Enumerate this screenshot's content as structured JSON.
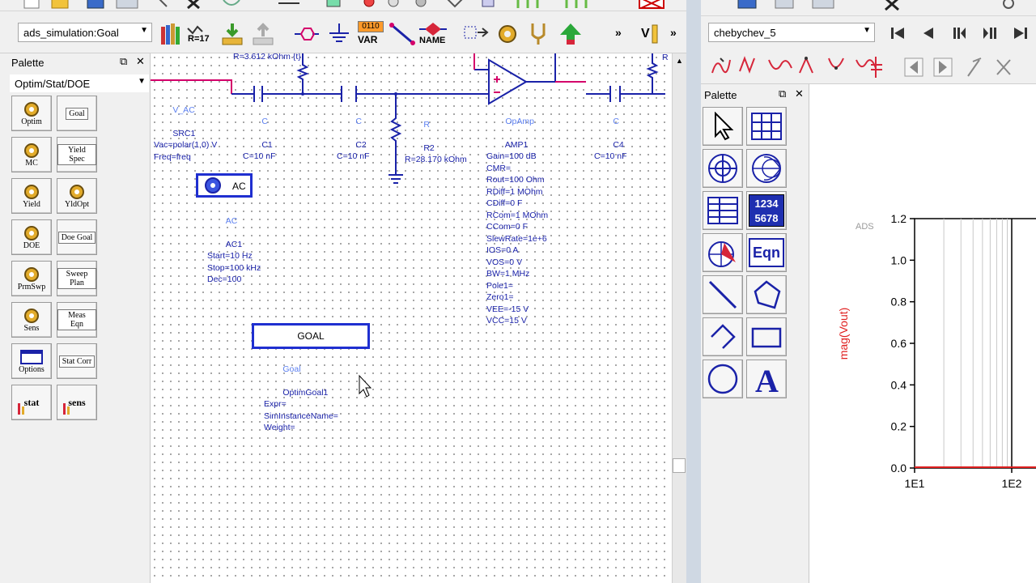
{
  "left": {
    "design_combo": "ads_simulation:Goal",
    "toolbar_texts": {
      "r17": "R=17",
      "var": "VAR",
      "var_bits": "0110",
      "name": "NAME",
      "more": "»",
      "vi": "V"
    },
    "palette": {
      "title": "Palette",
      "float": "⧉",
      "close": "✕",
      "category": "Optim/Stat/DOE",
      "items": [
        {
          "label": "Optim"
        },
        {
          "label": "Goal"
        },
        {
          "label": "MC"
        },
        {
          "label": "Yield Spec"
        },
        {
          "label": "Yield"
        },
        {
          "label": "YldOpt"
        },
        {
          "label": "DOE"
        },
        {
          "label": "Doe Goal"
        },
        {
          "label": "PrmSwp"
        },
        {
          "label": "Sweep Plan"
        },
        {
          "label": "Sens"
        },
        {
          "label": "Meas Eqn"
        },
        {
          "label": "Options"
        },
        {
          "label": "Stat Corr"
        },
        {
          "label": "stat"
        },
        {
          "label": "sens"
        }
      ]
    },
    "schematic": {
      "r1_text": "R=3.612 kOhm {t}",
      "src": {
        "type": "V_AC",
        "lines": "SRC1\nVac=polar(1,0) V\nFreq=freq"
      },
      "c1": {
        "type": "C",
        "lines": "C1\nC=10 nF"
      },
      "c2": {
        "type": "C",
        "lines": "C2\nC=10 nF"
      },
      "r2": {
        "type": "R",
        "lines": "R2\nR=28.170 kOhm"
      },
      "amp": {
        "type": "OpAmp",
        "lines": "AMP1\nGain=100 dB\nCMR=\nRout=100 Ohm\nRDiff=1 MOhm\nCDiff=0 F\nRCom=1 MOhm\nCCom=0 F\nSlewRate=1e+6\nIOS=0 A\nVOS=0 V\nBW=1 MHz\nPole1=\nZero1=\nVEE=-15 V\nVCC=15 V"
      },
      "c4": {
        "type": "C",
        "lines": "C4\nC=10 nF"
      },
      "r_right_text": "R",
      "ac_box": "AC",
      "ac": {
        "type": "AC",
        "lines": "AC1\nStart=10 Hz\nStop=100 kHz\nDec=100"
      },
      "goal_box": "GOAL",
      "goal": {
        "type": "Goal",
        "lines": "OptimGoal1\nExpr=\nSimInstanceName=\nWeight="
      }
    }
  },
  "right": {
    "combo": "chebychev_5",
    "palette": {
      "title": "Palette",
      "float": "⧉",
      "close": "✕",
      "numbers_top": "1234",
      "numbers_bottom": "5678",
      "eqn": "Eqn"
    },
    "plot": {
      "watermark": "ADS",
      "ylabel": "mag(Vout)",
      "yticks": [
        "1.2",
        "1.0",
        "0.8",
        "0.6",
        "0.4",
        "0.2",
        "0.0"
      ],
      "xticks": [
        "1E1",
        "1E2"
      ]
    }
  },
  "colors": {
    "wire": "#1a22a8",
    "probe_wire": "#d4006a",
    "box": "#1f2fd0",
    "trace": "#e02020"
  }
}
